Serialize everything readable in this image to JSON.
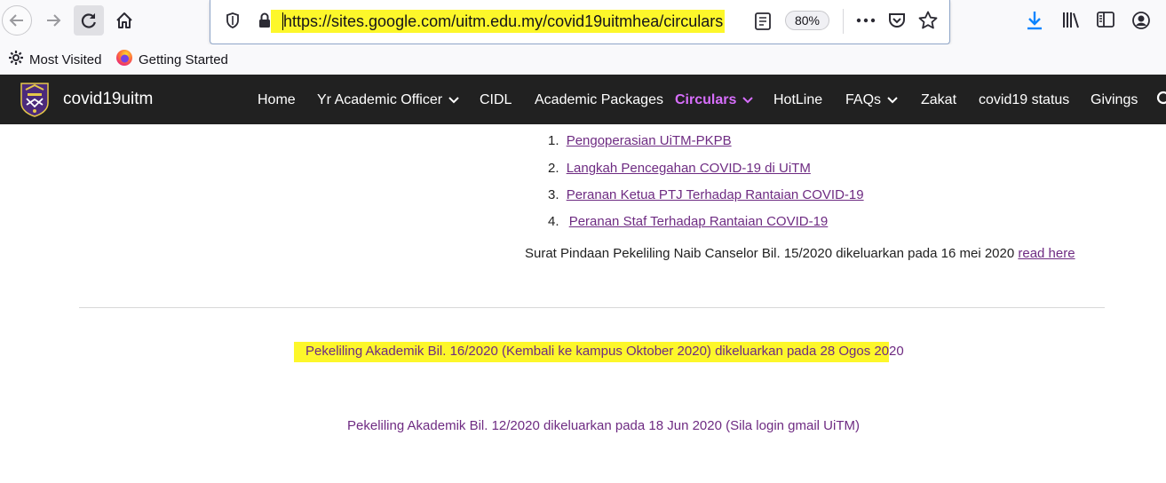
{
  "browser": {
    "url": "https://sites.google.com/uitm.edu.my/covid19uitmhea/circulars",
    "zoom": "80%",
    "icons": {
      "back": "back-arrow-icon",
      "forward": "forward-arrow-icon",
      "reload": "reload-icon",
      "home": "home-icon",
      "shield": "tracking-shield-icon",
      "lock": "lock-icon",
      "reader": "reader-view-icon",
      "more": "more-actions-icon",
      "pocket": "pocket-icon",
      "bookmark": "bookmark-star-icon",
      "downloads": "downloads-icon",
      "library": "library-icon",
      "sidebar": "sidebar-icon",
      "account": "account-icon"
    },
    "highlight_color": "#fdf72a",
    "download_color": "#0a84ff"
  },
  "bookmarks": {
    "items": [
      {
        "label": "Most Visited",
        "icon": "gear-icon"
      },
      {
        "label": "Getting Started",
        "icon": "firefox-icon"
      }
    ]
  },
  "site": {
    "title": "covid19uitm",
    "nav_bg": "#212121",
    "active_color": "#d76efb",
    "menu": [
      {
        "label": "Home",
        "dropdown": false,
        "active": false
      },
      {
        "label": "Yr Academic Officer",
        "dropdown": true,
        "active": false
      },
      {
        "label": "CIDL",
        "dropdown": false,
        "active": false
      },
      {
        "label": "Academic Packages",
        "dropdown": false,
        "active": false
      },
      {
        "label": "Circulars",
        "dropdown": true,
        "active": true
      },
      {
        "label": "HotLine",
        "dropdown": false,
        "active": false
      },
      {
        "label": "FAQs",
        "dropdown": true,
        "active": false
      },
      {
        "label": "Zakat",
        "dropdown": false,
        "active": false
      },
      {
        "label": "covid19 status",
        "dropdown": false,
        "active": false
      },
      {
        "label": "Givings",
        "dropdown": false,
        "active": false
      }
    ]
  },
  "content": {
    "link_color": "#6e2b82",
    "list": [
      {
        "num": "1.",
        "label": "Pengoperasian UiTM-PKPB"
      },
      {
        "num": "2.",
        "label": "Langkah Pencegahan COVID-19 di UiTM"
      },
      {
        "num": "3.",
        "label": "Peranan Ketua PTJ Terhadap Rantaian COVID-19"
      },
      {
        "num": "4.",
        "label": "Peranan Staf Terhadap Rantaian COVID-19"
      }
    ],
    "notice_text": "Surat Pindaan Pekeliling Naib Canselor Bil. 15/2020 dikeluarkan pada 16 mei 2020 ",
    "notice_link": "read here",
    "highlighted_link": "Pekeliling Akademik Bil. 16/2020 (Kembali ke kampus Oktober 2020) dikeluarkan pada 28 Ogos 2020",
    "second_link": "Pekeliling Akademik Bil. 12/2020 dikeluarkan pada 18 Jun 2020 (Sila login gmail UiTM)"
  }
}
